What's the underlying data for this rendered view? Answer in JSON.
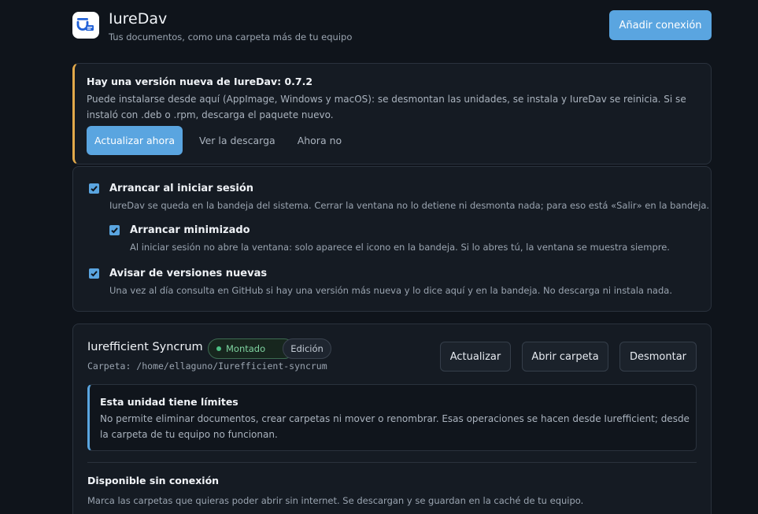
{
  "header": {
    "app_title": "IureDav",
    "app_subtitle": "Tus documentos, como una carpeta más de tu equipo",
    "add_connection_label": "Añadir conexión"
  },
  "update_notice": {
    "title": "Hay una versión nueva de IureDav: 0.7.2",
    "description": "Puede instalarse desde aquí (AppImage, Windows y macOS): se desmontan las unidades, se instala y IureDav se reinicia. Si se instaló con .deb o .rpm, descarga el paquete nuevo.",
    "update_now_label": "Actualizar ahora",
    "view_download_label": "Ver la descarga",
    "not_now_label": "Ahora no"
  },
  "settings": {
    "start_on_login": {
      "checked": true,
      "label": "Arrancar al iniciar sesión",
      "description": "IureDav se queda en la bandeja del sistema. Cerrar la ventana no lo detiene ni desmonta nada; para eso está «Salir» en la bandeja."
    },
    "start_minimized": {
      "checked": true,
      "label": "Arrancar minimizado",
      "description": "Al iniciar sesión no abre la ventana: solo aparece el icono en la bandeja. Si lo abres tú, la ventana se muestra siempre."
    },
    "notify_new_versions": {
      "checked": true,
      "label": "Avisar de versiones nuevas",
      "description": "Una vez al día consulta en GitHub si hay una versión más nueva y lo dice aquí y en la bandeja. No descarga ni instala nada."
    }
  },
  "drive": {
    "name": "Iurefficient Syncrum",
    "status_badge": "Montado",
    "mode_badge": "Edición",
    "path": "Carpeta: /home/ellaguno/Iurefficient-syncrum",
    "refresh_label": "Actualizar",
    "open_folder_label": "Abrir carpeta",
    "unmount_label": "Desmontar",
    "limits_title": "Esta unidad tiene límites",
    "limits_description": "No permite eliminar documentos, crear carpetas ni mover o renombrar. Esas operaciones se hacen desde Iurefficient; desde la carpeta de tu equipo no funcionan.",
    "offline_title": "Disponible sin conexión",
    "offline_description": "Marca las carpetas que quieras poder abrir sin internet. Se descargan y se guardan en la caché de tu equipo."
  },
  "colors": {
    "background": "#0f141b",
    "card": "#151b23",
    "accent": "#5aa5e0",
    "warning": "#e2a94a",
    "success": "#4cc184"
  },
  "icons": {
    "logo": "iuredav-logo-icon",
    "checkbox": "check-icon"
  }
}
